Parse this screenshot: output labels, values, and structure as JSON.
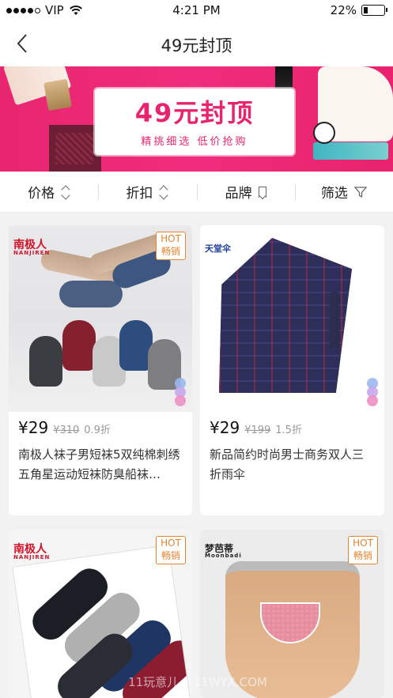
{
  "status_bar": {
    "carrier": "VIP",
    "time": "4:21 PM",
    "battery_percent": "22%",
    "battery_level": 0.22
  },
  "navbar": {
    "back_icon": "chevron-left-icon",
    "title": "49元封顶"
  },
  "banner": {
    "title": "49元封顶",
    "subtitle": "精挑细选 低价抢购",
    "accent_color": "#e8246f"
  },
  "filters": [
    {
      "label": "价格",
      "icon": "sort-icon"
    },
    {
      "label": "折扣",
      "icon": "sort-icon"
    },
    {
      "label": "品牌",
      "icon": "bookmark-icon"
    },
    {
      "label": "筛选",
      "icon": "filter-icon"
    }
  ],
  "hot_badge": {
    "line1": "HOT",
    "line2": "畅销"
  },
  "products": [
    {
      "brand": "南极人",
      "brand_en": "NANJIREN",
      "price": "¥29",
      "original_price": "¥310",
      "discount": "0.9折",
      "name": "南极人袜子男短袜5双纯棉刺绣五角星运动短袜防臭船袜…",
      "hot": true
    },
    {
      "brand": "天堂伞",
      "brand_en": "",
      "price": "¥29",
      "original_price": "¥199",
      "discount": "1.5折",
      "name": "新品简约时尚男士商务双人三折雨伞",
      "hot": false
    },
    {
      "brand": "南极人",
      "brand_en": "NANJIREN",
      "price": "",
      "original_price": "",
      "discount": "",
      "name": "",
      "hot": true
    },
    {
      "brand": "梦芭蒂",
      "brand_en": "Moonbadi",
      "price": "",
      "original_price": "",
      "discount": "",
      "name": "",
      "hot": true
    }
  ],
  "watermark": "11玩意儿 • 11WYX.COM"
}
